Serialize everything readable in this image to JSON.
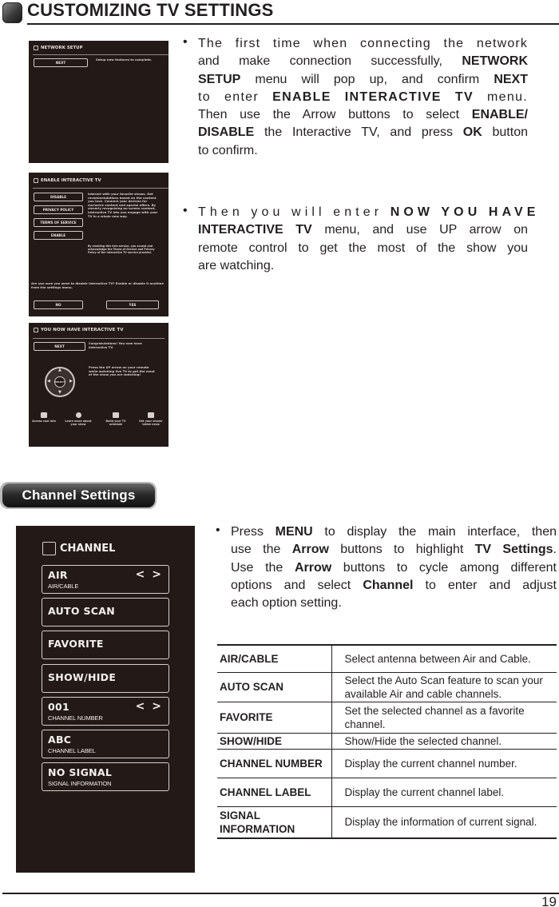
{
  "header": {
    "title": "CUSTOMIZING TV SETTINGS"
  },
  "screens": {
    "network_setup": {
      "title": "NETWORK SETUP",
      "button": "NEXT",
      "text": "Setup new features to complete."
    },
    "enable_interactive": {
      "title": "ENABLE INTERACTIVE TV",
      "buttons": [
        "DISABLE",
        "PRIVACY POLICY",
        "TERMS OF SERVICE",
        "ENABLE"
      ],
      "text1": "Interact with your favorite shows. Get recommendations based on the content you love. Connect your devices for exclusive content and special offers. By cleverly recognizing on-screen content, Interactive TV lets you engage with your TV in a whole new way.",
      "text2": "By enabling this free service, you accept and acknowledge the Terms of Service and Privacy Policy of the Interactive TV service provider.",
      "question": "Are you sure you want to disable Interactive TV? Enable or disable it anytime from the settings menu.",
      "no": "NO",
      "yes": "YES"
    },
    "now_interactive": {
      "title": "YOU NOW HAVE INTERACTIVE TV",
      "button": "NEXT",
      "text1": "Congratulations! You now have Interactive TV.",
      "text2": "Press the UP arrow on your remote while watching live TV to get the most of the show you are watching!",
      "dial_center": "SELECT",
      "features": [
        {
          "icon": "people-icon",
          "label": "Access cool info"
        },
        {
          "icon": "info-icon",
          "label": "Learn more about your show"
        },
        {
          "icon": "calendar-icon",
          "label": "Build your TV schedule"
        },
        {
          "icon": "news-icon",
          "label": "Get your shows' latest news"
        }
      ]
    }
  },
  "instructions": {
    "p1": {
      "l1": "The first time when connecting the network",
      "l2a": "and make connection successfully, ",
      "l2b": "NETWORK",
      "l3a": "SETUP",
      "l3b": " menu will pop up, and confirm ",
      "l3c": "NEXT",
      "l4a": "to enter ",
      "l4b": "ENABLE INTERACTIVE TV",
      "l4c": " menu.",
      "l5a": "Then use the Arrow buttons to select ",
      "l5b": "ENABLE/",
      "l6a": "DISABLE",
      "l6b": " the Interactive TV, and press ",
      "l6c": "OK",
      "l6d": " button",
      "l7": "to confirm."
    },
    "p2": {
      "l1a": "Then you will enter ",
      "l1b": "NOW YOU HAVE",
      "l2a": "INTERACTIVE TV",
      "l2b": " menu, and use UP arrow on",
      "l3": "remote control to get the most of the show you",
      "l4": "are watching."
    }
  },
  "section": {
    "label": "Channel Settings"
  },
  "channel_menu": {
    "title": "CHANNEL",
    "items": [
      {
        "main": "AIR",
        "sub": "AIR/CABLE",
        "arrows": "< >"
      },
      {
        "main": "AUTO SCAN",
        "sub": "",
        "arrows": ""
      },
      {
        "main": "FAVORITE",
        "sub": "",
        "arrows": ""
      },
      {
        "main": "SHOW/HIDE",
        "sub": "",
        "arrows": ""
      },
      {
        "main": "001",
        "sub": "CHANNEL NUMBER",
        "arrows": "< >"
      },
      {
        "main": "ABC",
        "sub": "CHANNEL LABEL",
        "arrows": ""
      },
      {
        "main": "NO SIGNAL",
        "sub": "SIGNAL INFORMATION",
        "arrows": ""
      }
    ]
  },
  "channel_instructions": {
    "l1a": "Press ",
    "l1b": "MENU",
    "l1c": " to display the main interface, then",
    "l2a": "use the ",
    "l2b": "Arrow",
    "l2c": " buttons to highlight ",
    "l2d": "TV Settings",
    "l2e": ".",
    "l3a": "Use the ",
    "l3b": "Arrow",
    "l3c": " buttons to cycle among different",
    "l4a": "options and select ",
    "l4b": "Channel",
    "l4c": " to enter and adjust",
    "l5": "each option setting."
  },
  "table": {
    "rows": [
      {
        "key": "AIR/CABLE",
        "value": "Select antenna between Air and Cable."
      },
      {
        "key": "AUTO SCAN",
        "value": "Select the Auto Scan feature to scan your available Air and cable channels."
      },
      {
        "key": "FAVORITE",
        "value": "Set the selected channel as a favorite channel."
      },
      {
        "key": "SHOW/HIDE",
        "value": "Show/Hide the selected channel."
      },
      {
        "key": "CHANNEL NUMBER",
        "value": "Display the current channel number."
      },
      {
        "key": "CHANNEL LABEL",
        "value": "Display the current channel label."
      },
      {
        "key": "SIGNAL INFORMATION",
        "value": "Display the information of current signal."
      }
    ]
  },
  "footer": {
    "page_number": "19"
  }
}
